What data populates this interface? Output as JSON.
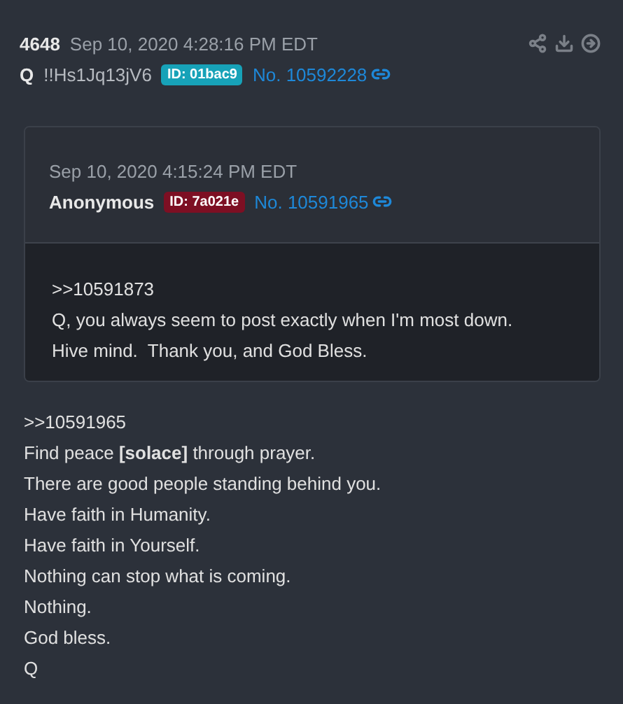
{
  "post": {
    "number": "4648",
    "date": "Sep 10, 2020 4:28:16 PM EDT",
    "author": "Q",
    "tripcode": "!!Hs1Jq13jV6",
    "id_badge": {
      "text": "ID: 01bac9",
      "color": "#17a2b8"
    },
    "post_no": "No. 10592228"
  },
  "quote": {
    "date": "Sep 10, 2020 4:15:24 PM EDT",
    "author": "Anonymous",
    "id_badge": {
      "text": "ID: 7a021e",
      "color": "#7d0f23"
    },
    "post_no": "No. 10591965",
    "lines": [
      ">>10591873",
      "Q, you always seem to post exactly when I'm most down.",
      "Hive mind.  Thank you, and God Bless."
    ]
  },
  "lines": [
    ">>10591965",
    "Find peace **[solace]** through prayer.",
    "There are good people standing behind you.",
    "Have faith in Humanity.",
    "Have faith in Yourself.",
    "Nothing can stop what is coming.",
    "Nothing.",
    "God bless.",
    "Q"
  ]
}
